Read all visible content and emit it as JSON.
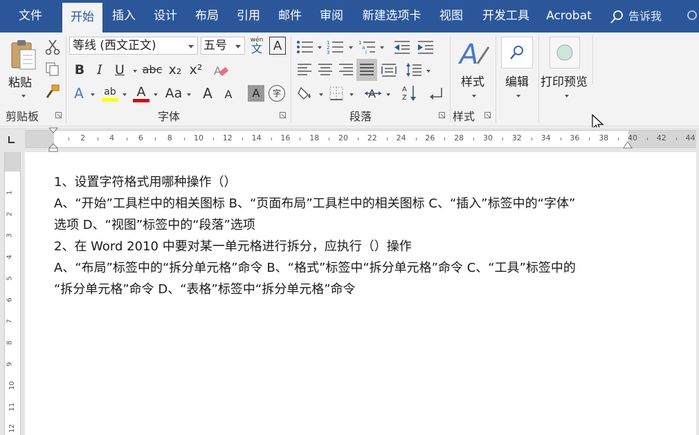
{
  "tabs": [
    "文件",
    "开始",
    "插入",
    "设计",
    "布局",
    "引用",
    "邮件",
    "审阅",
    "新建选项卡",
    "视图",
    "开发工具",
    "Acrobat"
  ],
  "active_tab": "开始",
  "tell_me": "告诉我",
  "ribbon": {
    "clipboard": {
      "paste": "粘贴",
      "group": "剪贴板"
    },
    "font": {
      "font_name": "等线 (西文正文)",
      "font_size": "五号",
      "phonetic": "wén",
      "border_char": "A",
      "bold": "B",
      "italic": "I",
      "underline": "U",
      "strike": "abc",
      "subscript": "x₂",
      "superscript": "x²",
      "grow": "A",
      "shrink": "A",
      "case": "Aa",
      "effects": "A",
      "highlight": "ab",
      "font_color": "A",
      "shading": "A",
      "enclose": "字",
      "group": "字体"
    },
    "paragraph": {
      "group": "段落"
    },
    "styles": {
      "label": "样式",
      "group": "样式"
    },
    "editing": {
      "label": "编辑"
    },
    "print_preview": {
      "label": "打印预览"
    }
  },
  "ruler": {
    "numbers": [
      "2",
      "4",
      "6",
      "8",
      "10",
      "12",
      "14",
      "16",
      "18",
      "20",
      "22",
      "24",
      "26",
      "28",
      "30",
      "32",
      "34",
      "36",
      "38",
      "40",
      "42",
      "44"
    ],
    "vnumbers": [
      "1",
      "2",
      "3",
      "4",
      "5",
      "6",
      "7",
      "8",
      "9",
      "10",
      "11",
      "12"
    ]
  },
  "document": {
    "lines": [
      "1、设置字符格式用哪种操作（）",
      "A、“开始”工具栏中的相关图标 B、“页面布局”工具栏中的相关图标 C、“插入”标签中的“字体”",
      "选项 D、“视图”标签中的“段落”选项",
      "2、在 Word 2010 中要对某一单元格进行拆分，应执行（）操作",
      "A、“布局”标签中的“拆分单元格”命令 B、“格式”标签中“拆分单元格”命令 C、“工具”标签中的",
      "“拆分单元格”命令 D、“表格”标签中“拆分单元格”命令"
    ]
  },
  "colors": {
    "accent": "#2b579a",
    "highlight": "#ffff00",
    "font_red": "#e00000"
  }
}
